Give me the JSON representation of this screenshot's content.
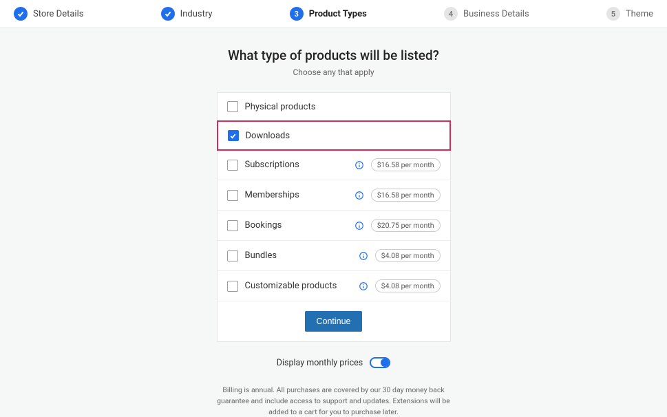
{
  "stepper": [
    {
      "label": "Store Details",
      "state": "done"
    },
    {
      "label": "Industry",
      "state": "done"
    },
    {
      "label": "Product Types",
      "state": "current",
      "num": "3"
    },
    {
      "label": "Business Details",
      "state": "upcoming",
      "num": "4"
    },
    {
      "label": "Theme",
      "state": "upcoming",
      "num": "5"
    }
  ],
  "heading": {
    "title": "What type of products will be listed?",
    "subtitle": "Choose any that apply"
  },
  "options": [
    {
      "label": "Physical products",
      "checked": false
    },
    {
      "label": "Downloads",
      "checked": true,
      "highlight": true
    },
    {
      "label": "Subscriptions",
      "checked": false,
      "info": true,
      "price": "$16.58 per month"
    },
    {
      "label": "Memberships",
      "checked": false,
      "info": true,
      "price": "$16.58 per month"
    },
    {
      "label": "Bookings",
      "checked": false,
      "info": true,
      "price": "$20.75 per month"
    },
    {
      "label": "Bundles",
      "checked": false,
      "info": true,
      "price": "$4.08 per month"
    },
    {
      "label": "Customizable products",
      "checked": false,
      "info": true,
      "price": "$4.08 per month"
    }
  ],
  "continue_label": "Continue",
  "toggle": {
    "label": "Display monthly prices",
    "on": true
  },
  "fineprint": "Billing is annual. All purchases are covered by our 30 day money back guarantee and include access to support and updates. Extensions will be added to a cart for you to purchase later."
}
